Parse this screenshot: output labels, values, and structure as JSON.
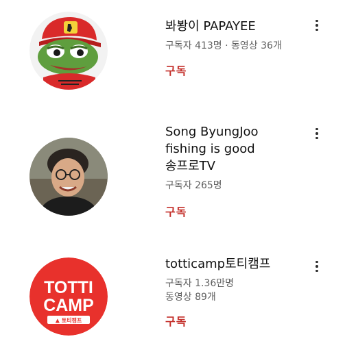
{
  "channels": [
    {
      "name": "봐봥이 PAPAYEE",
      "meta": [
        "구독자 413명 · 동영상 36개"
      ],
      "subscribe_label": "구독"
    },
    {
      "name_lines": [
        "Song ByungJoo",
        "fishing is good",
        "송프로TV"
      ],
      "meta": [
        "구독자 265명"
      ],
      "subscribe_label": "구독"
    },
    {
      "name": "totticamp토티캠프",
      "meta": [
        "구독자 1.36만명",
        "동영상 89개"
      ],
      "subscribe_label": "구독",
      "logo": {
        "line1": "TOTTI",
        "line2": "CAMP",
        "tag": "▲ 토티캠프"
      }
    }
  ],
  "colors": {
    "subscribe_red": "#c4302b",
    "totti_red": "#e8312c"
  },
  "icons": [
    "more-vert-icon"
  ]
}
